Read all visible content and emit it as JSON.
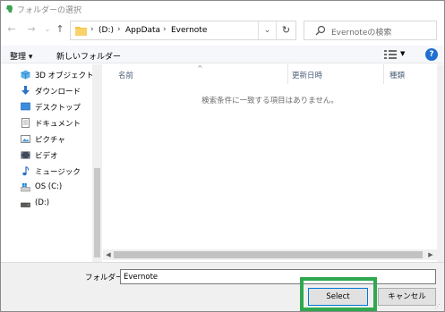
{
  "window": {
    "title": "フォルダーの選択"
  },
  "address_bar": {
    "crumbs": [
      "(D:)",
      "AppData",
      "Evernote"
    ],
    "separator": "›"
  },
  "search": {
    "placeholder": "Evernoteの検索"
  },
  "toolbar": {
    "organize_label": "整理 ▾",
    "new_folder_label": "新しいフォルダー"
  },
  "sidebar": {
    "items": [
      {
        "label": "3D オブジェクト",
        "icon": "cube-icon"
      },
      {
        "label": "ダウンロード",
        "icon": "download-arrow-icon"
      },
      {
        "label": "デスクトップ",
        "icon": "desktop-icon"
      },
      {
        "label": "ドキュメント",
        "icon": "document-icon"
      },
      {
        "label": "ピクチャ",
        "icon": "picture-icon"
      },
      {
        "label": "ビデオ",
        "icon": "video-icon"
      },
      {
        "label": "ミュージック",
        "icon": "music-note-icon"
      },
      {
        "label": "OS (C:)",
        "icon": "windows-drive-icon"
      },
      {
        "label": "(D:)",
        "icon": "drive-icon"
      }
    ]
  },
  "content": {
    "columns": [
      "名前",
      "更新日時",
      "種類"
    ],
    "empty_message": "検索条件に一致する項目はありません。"
  },
  "footer": {
    "folder_label": "フォルダー:",
    "folder_value": "Evernote",
    "select_label": "Select",
    "cancel_label": "キャンセル"
  },
  "colors": {
    "highlight": "#2fa84f",
    "accent": "#0078d7"
  }
}
